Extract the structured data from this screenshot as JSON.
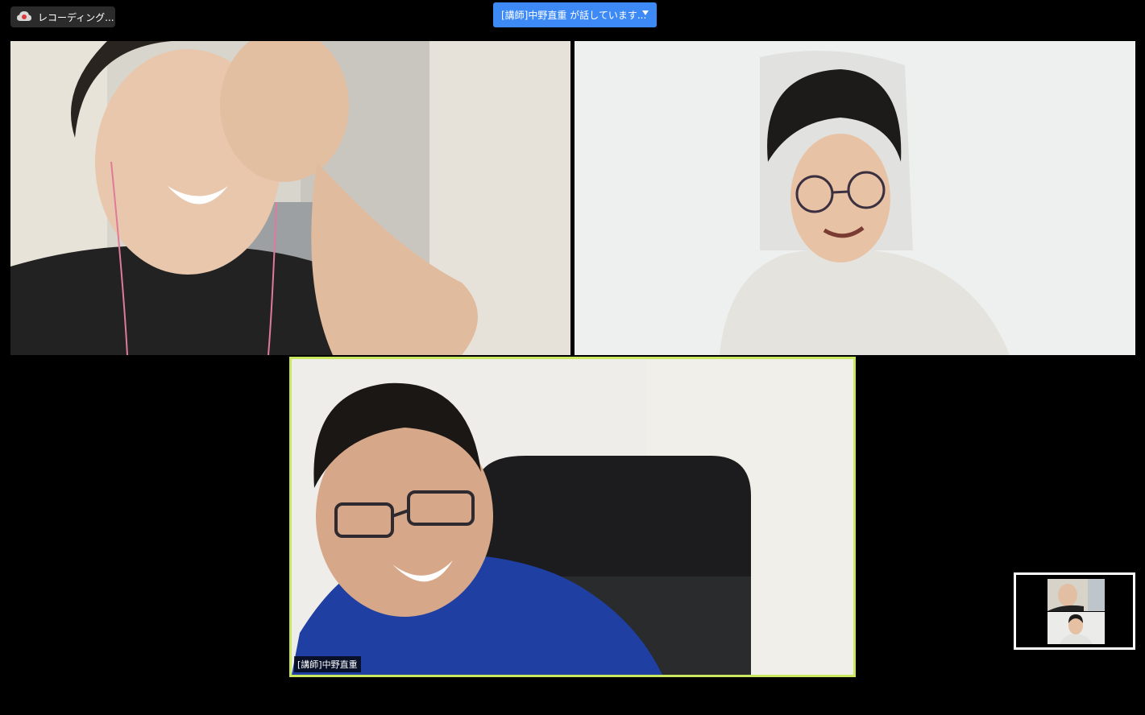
{
  "recording": {
    "label": "レコーディング...",
    "icon": "cloud-record-icon"
  },
  "active_speaker": {
    "label": "[講師]中野直重 が話しています...",
    "icon": "chevron-down-icon"
  },
  "participants": [
    {
      "name": ""
    },
    {
      "name": ""
    },
    {
      "name": "[講師]中野直重",
      "highlight_color": "#c9e85f"
    }
  ],
  "colors": {
    "background": "#000000",
    "speaker_banner": "#3d8af7",
    "active_border": "#c9e85f"
  }
}
